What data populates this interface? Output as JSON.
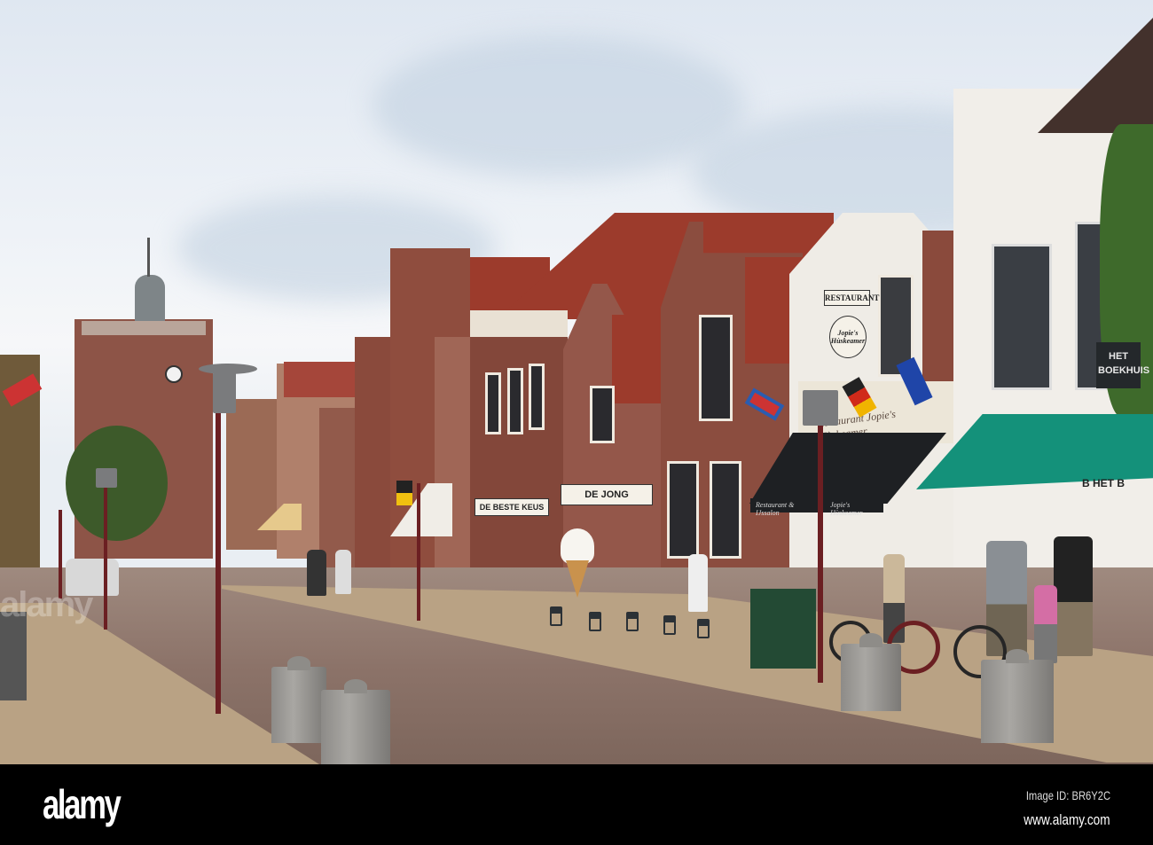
{
  "scene": {
    "description_label": "Town street with shops and church tower",
    "signs": {
      "restaurant": "RESTAURANT",
      "round_sign": "Jopie's Hùskeamer",
      "facade_lettering": "Restaurant Jopie's Hùskeamer",
      "awning_left": "Restaurant & IJssalon",
      "awning_right": "Jopie's Hùskeamer",
      "bookshop": "HET BOEKHUIS",
      "bookshop_awning": "B HET B",
      "shop_1": "DE BESTE KEUS",
      "shop_2": "DE JONG"
    },
    "colors": {
      "sky": "#eef2f7",
      "brick": "#8a4a3c",
      "roof": "#9c3b2c",
      "awning_green": "#14917a",
      "awning_black": "#1e2023"
    }
  },
  "watermark": {
    "logo": "alamy",
    "image_id": "Image ID: BR6Y2C",
    "website": "www.alamy.com",
    "overlay": "alamy"
  }
}
